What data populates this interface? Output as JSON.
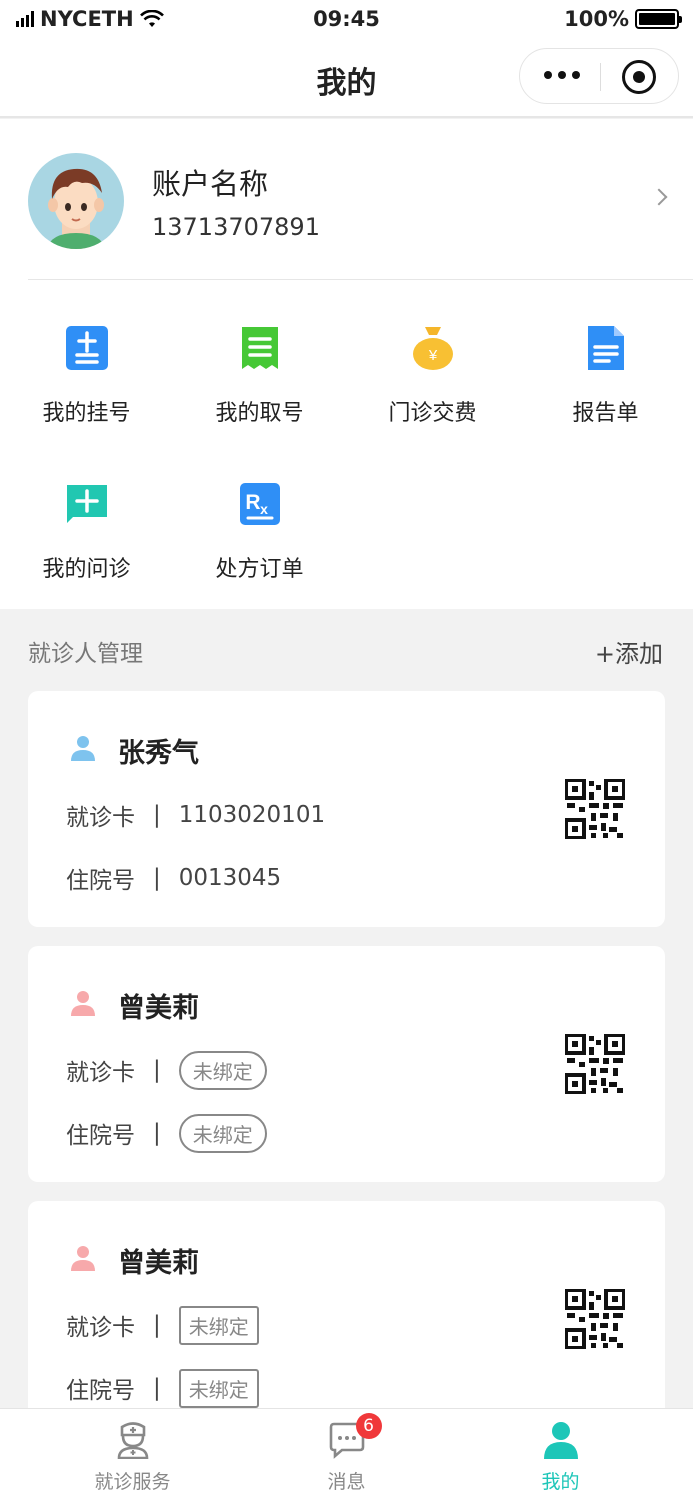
{
  "status": {
    "carrier": "NYCETH",
    "time": "09:45",
    "battery": "100%"
  },
  "nav": {
    "title": "我的"
  },
  "profile": {
    "name": "账户名称",
    "phone": "13713707891"
  },
  "functions": [
    {
      "label": "我的挂号",
      "icon": "register-icon"
    },
    {
      "label": "我的取号",
      "icon": "queue-ticket-icon"
    },
    {
      "label": "门诊交费",
      "icon": "money-bag-icon"
    },
    {
      "label": "报告单",
      "icon": "report-icon"
    },
    {
      "label": "我的问诊",
      "icon": "consultation-icon"
    },
    {
      "label": "处方订单",
      "icon": "prescription-icon"
    }
  ],
  "patients": {
    "section_title": "就诊人管理",
    "add_label": "+添加",
    "card_label": "就诊卡",
    "hospital_label": "住院号",
    "separator": "|",
    "list": [
      {
        "name": "张秀气",
        "card": "1103020101",
        "hospital_no": "0013045",
        "color": "#7ec3ee"
      },
      {
        "name": "曾美莉",
        "card": "未绑定",
        "hospital_no": "未绑定",
        "color": "#f7a9ab"
      },
      {
        "name": "曾美莉",
        "card": "未绑定",
        "hospital_no": "未绑定",
        "color": "#f7a9ab"
      }
    ]
  },
  "tabs": [
    {
      "label": "就诊服务",
      "icon": "nurse-icon"
    },
    {
      "label": "消息",
      "icon": "message-icon",
      "badge": "6"
    },
    {
      "label": "我的",
      "icon": "person-icon",
      "active": true
    }
  ],
  "colors": {
    "accent": "#1dc6b8",
    "badge": "#f0383a"
  }
}
